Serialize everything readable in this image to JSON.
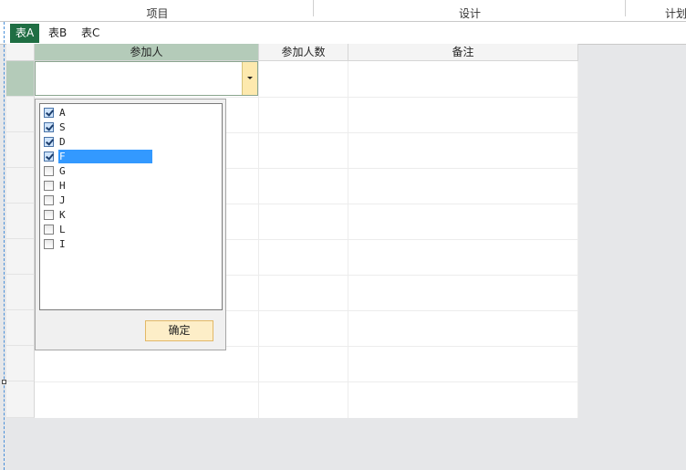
{
  "header": {
    "columns": [
      "项目",
      "设计",
      "计划"
    ]
  },
  "tabs": [
    {
      "label": "表A",
      "active": true
    },
    {
      "label": "表B",
      "active": false
    },
    {
      "label": "表C",
      "active": false
    }
  ],
  "table": {
    "columns": [
      "参加人",
      "参加人数",
      "备注"
    ],
    "selected_column": "参加人"
  },
  "dropdown": {
    "items": [
      {
        "label": "A",
        "checked": true
      },
      {
        "label": "S",
        "checked": true
      },
      {
        "label": "D",
        "checked": true
      },
      {
        "label": "F",
        "checked": true,
        "highlighted": true
      },
      {
        "label": "G",
        "checked": false
      },
      {
        "label": "H",
        "checked": false
      },
      {
        "label": "J",
        "checked": false
      },
      {
        "label": "K",
        "checked": false
      },
      {
        "label": "L",
        "checked": false
      },
      {
        "label": "I",
        "checked": false
      }
    ],
    "confirm_label": "确定"
  },
  "colors": {
    "tab_active": "#1f6e43",
    "selected_header": "#b4cbb9",
    "highlight": "#3399ff",
    "confirm_button": "#fdeec8"
  }
}
